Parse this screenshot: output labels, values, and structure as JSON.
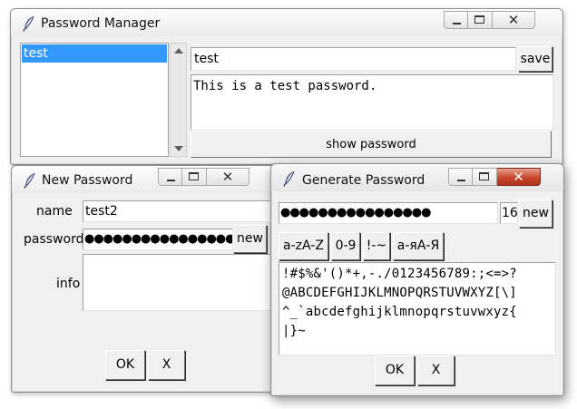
{
  "window_controls": {
    "minimize": "—",
    "maximize": "□",
    "close": "✕"
  },
  "password_manager": {
    "title": "Password Manager",
    "list_items": [
      "test"
    ],
    "name_value": "test",
    "save_label": "save",
    "info_text": "This is a test password.",
    "show_password_label": "show password"
  },
  "new_password": {
    "title": "New Password",
    "name_label": "name",
    "name_value": "test2",
    "password_label": "password",
    "password_value": "●●●●●●●●●●●●●●●●●●",
    "new_label": "new",
    "info_label": "info",
    "info_value": "",
    "ok_label": "OK",
    "cancel_label": "X"
  },
  "generate_password": {
    "title": "Generate Password",
    "password_value": "●●●●●●●●●●●●●●●●",
    "length_value": "16",
    "new_label": "new",
    "charset_buttons": [
      "a-zA-Z",
      "0-9",
      "!-~",
      "а-яА-Я"
    ],
    "charset_lines": [
      "!#$%&'()*+,-./0123456789:;<=>?",
      "@ABCDEFGHIJKLMNOPQRSTUVWXYZ[\\]",
      "^_`abcdefghijklmnopqrstuvwxyz{",
      "|}~"
    ],
    "ok_label": "OK",
    "cancel_label": "X"
  }
}
